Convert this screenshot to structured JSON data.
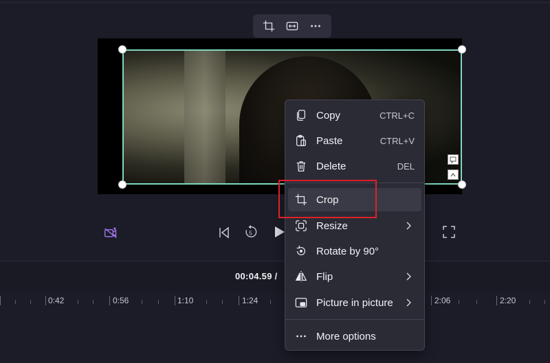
{
  "toolbar": {
    "crop_icon": "crop-icon",
    "fit_icon": "fit-width-icon",
    "more_icon": "more-icon"
  },
  "player": {
    "current_time": "00:04.59 /",
    "skip_back_seconds": "5"
  },
  "timeline": {
    "ticks": [
      "0:42",
      "0:56",
      "1:10",
      "1:24",
      "2:06",
      "2:20"
    ]
  },
  "context_menu": {
    "items": [
      {
        "label": "Copy",
        "shortcut": "CTRL+C",
        "icon": "copy-icon"
      },
      {
        "label": "Paste",
        "shortcut": "CTRL+V",
        "icon": "paste-icon"
      },
      {
        "label": "Delete",
        "shortcut": "DEL",
        "icon": "trash-icon"
      },
      {
        "label": "Crop",
        "shortcut": "",
        "icon": "crop-icon"
      },
      {
        "label": "Resize",
        "shortcut": "",
        "icon": "resize-icon"
      },
      {
        "label": "Rotate by 90°",
        "shortcut": "",
        "icon": "rotate-icon"
      },
      {
        "label": "Flip",
        "shortcut": "",
        "icon": "flip-icon"
      },
      {
        "label": "Picture in picture",
        "shortcut": "",
        "icon": "pip-icon"
      },
      {
        "label": "More options",
        "shortcut": "",
        "icon": "ellipsis-icon"
      }
    ]
  },
  "colors": {
    "selection": "#7ed8c0",
    "highlight": "#e0202a",
    "accent": "#a67cf0"
  }
}
